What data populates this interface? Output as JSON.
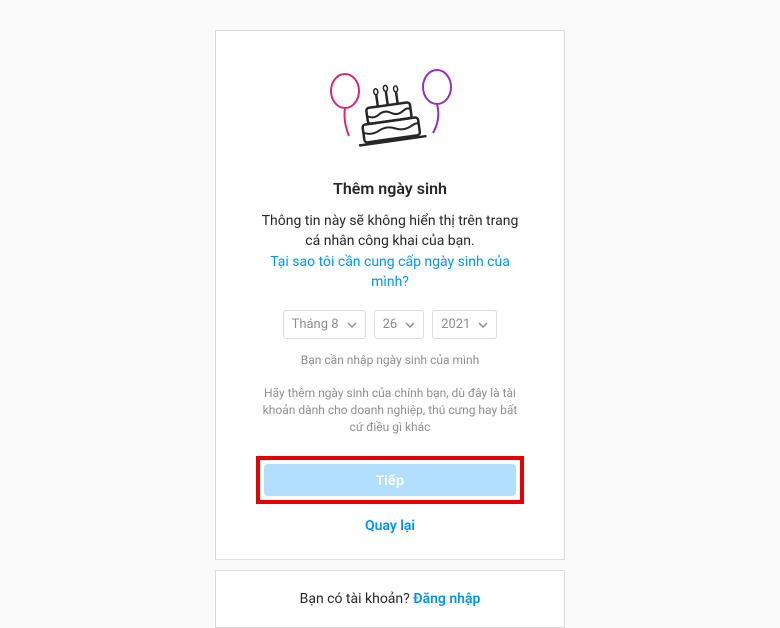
{
  "title": "Thêm ngày sinh",
  "description": "Thông tin này sẽ không hiển thị trên trang cá nhân công khai của bạn.",
  "why_link": "Tại sao tôi cần cung cấp ngày sinh của mình?",
  "selects": {
    "month": "Tháng 8",
    "day": "26",
    "year": "2021"
  },
  "hint": "Bạn cần nhập ngày sinh của mình",
  "note": "Hãy thêm ngày sinh của chính bạn, dù đây là tài khoản dành cho doanh nghiệp, thú cưng hay bất cứ điều gì khác",
  "next_button": "Tiếp",
  "back_link": "Quay lại",
  "login_prompt": "Bạn có tài khoản? ",
  "login_link": "Đăng nhập"
}
